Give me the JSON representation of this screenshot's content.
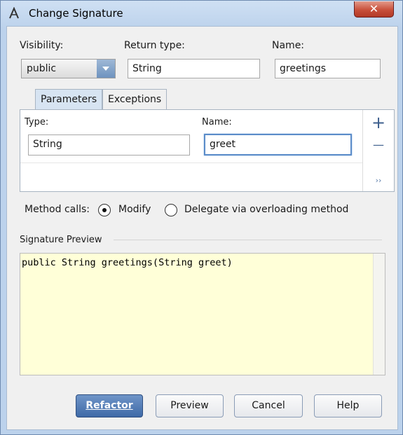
{
  "window": {
    "title": "Change Signature",
    "close_label": "✕"
  },
  "visibility": {
    "label": "Visibility:",
    "value": "public"
  },
  "return_type": {
    "label": "Return type:",
    "value": "String"
  },
  "name": {
    "label": "Name:",
    "value": "greetings"
  },
  "tabs": [
    {
      "label": "Parameters",
      "active": true
    },
    {
      "label": "Exceptions",
      "active": false
    }
  ],
  "params": {
    "type_label": "Type:",
    "name_label": "Name:",
    "type_value": "String",
    "name_value": "greet",
    "add_label": "+",
    "remove_label": "—",
    "more_label": "››"
  },
  "method_calls": {
    "label": "Method calls:",
    "options": [
      {
        "label": "Modify",
        "checked": true
      },
      {
        "label": "Delegate via overloading method",
        "checked": false
      }
    ]
  },
  "preview": {
    "label": "Signature Preview",
    "code": "public String greetings(String greet)"
  },
  "buttons": {
    "refactor": "Refactor",
    "preview": "Preview",
    "cancel": "Cancel",
    "help": "Help"
  }
}
